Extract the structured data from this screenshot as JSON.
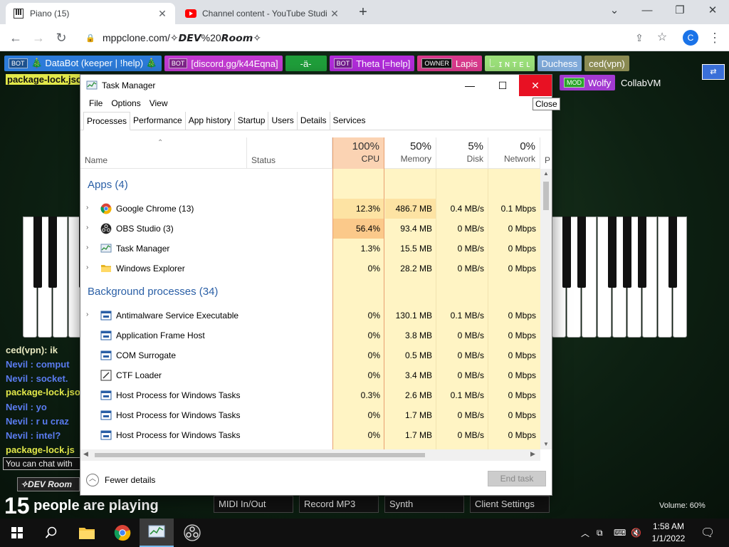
{
  "browser": {
    "tabs": [
      {
        "title": "Piano (15)",
        "active": true
      },
      {
        "title": "Channel content - YouTube Studi",
        "active": false
      }
    ],
    "url": "mppclone.com/✧𝘿𝙀𝙑%20𝙍𝙤𝙤𝙢✧",
    "profile_initial": "C"
  },
  "piano_page": {
    "users": [
      {
        "tag": "BOT",
        "name": "🎄 DataBot (keeper | !help) 🎄",
        "color": "#2c7bd9"
      },
      {
        "tag": "BOT",
        "name": "[discord.gg/k44Eqna]",
        "color": "#c23ad1"
      },
      {
        "tag": "",
        "name": "-ä-",
        "color": "#1f9e3a"
      },
      {
        "tag": "BOT",
        "name": "Theta [=help]",
        "color": "#b02cd9"
      },
      {
        "tag": "OWNER",
        "name": "Lapis",
        "color": "#d93a8c"
      },
      {
        "tag": "",
        "name": "꒒ ɪ ɴ ᴛ ᴇ ʟ",
        "color": "#9be07a"
      },
      {
        "tag": "",
        "name": "Duchess",
        "color": "#7fa9d9"
      },
      {
        "tag": "",
        "name": "ced(vpn)",
        "color": "#8a8a52"
      },
      {
        "tag": "MOD",
        "name": "Wolfy",
        "color": "#a33ad1"
      },
      {
        "tag": "",
        "name": "CollabVM",
        "color": "transparent"
      }
    ],
    "chat": [
      {
        "text": "package-lock.json",
        "color": "#e2e84a"
      },
      {
        "text": "ced(vpn): ik",
        "color": "#e8e8c0"
      },
      {
        "text": "Nevil : comput",
        "color": "#5a7cf0"
      },
      {
        "text": "Nevil : socket.",
        "color": "#5a7cf0"
      },
      {
        "text": "package-lock.json",
        "color": "#e2e84a"
      },
      {
        "text": "Nevil : yo",
        "color": "#5a7cf0"
      },
      {
        "text": "Nevil : r u craz",
        "color": "#5a7cf0"
      },
      {
        "text": "Nevil : intel?",
        "color": "#5a7cf0"
      },
      {
        "text": "package-lock.js",
        "color": "#e2e84a"
      }
    ],
    "chat_hint": "You can chat with",
    "room_tag": "✧DEV Room",
    "players_count": "15",
    "players_text": "people are playing",
    "buttons": [
      "MIDI In/Out",
      "Record MP3",
      "Synth",
      "Client Settings"
    ],
    "volume": "Volume: 60%"
  },
  "task_manager": {
    "title": "Task Manager",
    "menu": [
      "File",
      "Options",
      "View"
    ],
    "tabs": [
      "Processes",
      "Performance",
      "App history",
      "Startup",
      "Users",
      "Details",
      "Services"
    ],
    "active_tab": "Processes",
    "tooltip": "Close",
    "columns": {
      "name": "Name",
      "status": "Status",
      "cpu_pct": "100%",
      "cpu": "CPU",
      "mem_pct": "50%",
      "mem": "Memory",
      "disk_pct": "5%",
      "disk": "Disk",
      "net_pct": "0%",
      "net": "Network",
      "extra": "P"
    },
    "apps_header": "Apps (4)",
    "bg_header": "Background processes (34)",
    "apps": [
      {
        "name": "Google Chrome (13)",
        "cpu": "12.3%",
        "mem": "486.7 MB",
        "disk": "0.4 MB/s",
        "net": "0.1 Mbps",
        "icon": "chrome-icon"
      },
      {
        "name": "OBS Studio (3)",
        "cpu": "56.4%",
        "mem": "93.4 MB",
        "disk": "0 MB/s",
        "net": "0 Mbps",
        "icon": "obs-icon"
      },
      {
        "name": "Task Manager",
        "cpu": "1.3%",
        "mem": "15.5 MB",
        "disk": "0 MB/s",
        "net": "0 Mbps",
        "icon": "taskmgr-icon"
      },
      {
        "name": "Windows Explorer",
        "cpu": "0%",
        "mem": "28.2 MB",
        "disk": "0 MB/s",
        "net": "0 Mbps",
        "icon": "folder-icon"
      }
    ],
    "background": [
      {
        "name": "Antimalware Service Executable",
        "cpu": "0%",
        "mem": "130.1 MB",
        "disk": "0.1 MB/s",
        "net": "0 Mbps",
        "expand": true
      },
      {
        "name": "Application Frame Host",
        "cpu": "0%",
        "mem": "3.8 MB",
        "disk": "0 MB/s",
        "net": "0 Mbps",
        "expand": false
      },
      {
        "name": "COM Surrogate",
        "cpu": "0%",
        "mem": "0.5 MB",
        "disk": "0 MB/s",
        "net": "0 Mbps",
        "expand": false
      },
      {
        "name": "CTF Loader",
        "cpu": "0%",
        "mem": "3.4 MB",
        "disk": "0 MB/s",
        "net": "0 Mbps",
        "expand": false
      },
      {
        "name": "Host Process for Windows Tasks",
        "cpu": "0.3%",
        "mem": "2.6 MB",
        "disk": "0.1 MB/s",
        "net": "0 Mbps",
        "expand": false
      },
      {
        "name": "Host Process for Windows Tasks",
        "cpu": "0%",
        "mem": "1.7 MB",
        "disk": "0 MB/s",
        "net": "0 Mbps",
        "expand": false
      },
      {
        "name": "Host Process for Windows Tasks",
        "cpu": "0%",
        "mem": "1.7 MB",
        "disk": "0 MB/s",
        "net": "0 Mbps",
        "expand": false
      }
    ],
    "fewer_details": "Fewer details",
    "end_task": "End task"
  },
  "taskbar": {
    "time": "1:58 AM",
    "date": "1/1/2022"
  }
}
